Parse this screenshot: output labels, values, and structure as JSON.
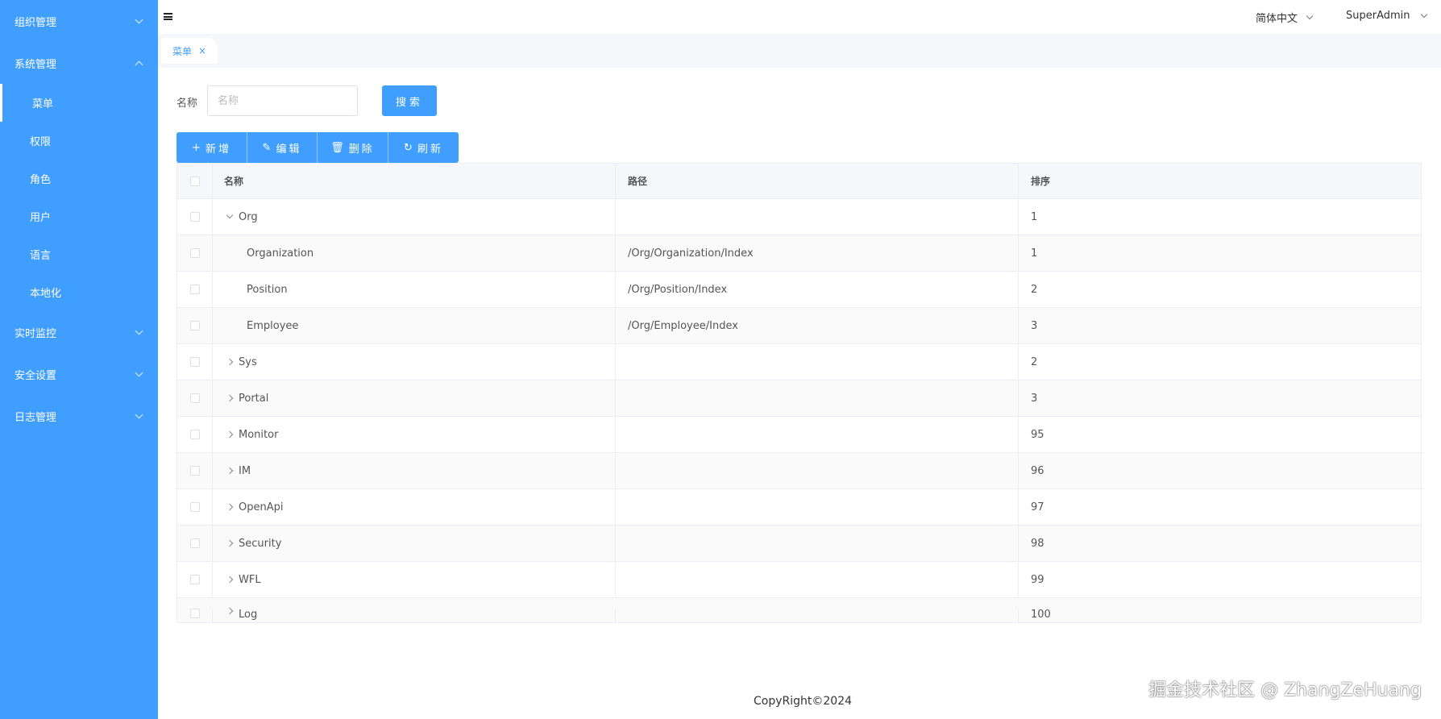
{
  "sidebar": {
    "groups": [
      {
        "label": "组织管理",
        "expanded": false
      },
      {
        "label": "系统管理",
        "expanded": true
      },
      {
        "label": "实时监控",
        "expanded": false
      },
      {
        "label": "安全设置",
        "expanded": false
      },
      {
        "label": "日志管理",
        "expanded": false
      }
    ],
    "system_items": [
      "菜单",
      "权限",
      "角色",
      "用户",
      "语言",
      "本地化"
    ],
    "active_item": "菜单"
  },
  "header": {
    "language": "简体中文",
    "user": "SuperAdmin"
  },
  "tabs": [
    {
      "label": "菜单",
      "close": "×"
    }
  ],
  "search": {
    "label": "名称",
    "placeholder": "名称",
    "button": "搜索"
  },
  "toolbar": {
    "add": "新增",
    "edit": "编辑",
    "delete": "删除",
    "refresh": "刷新"
  },
  "table": {
    "headers": [
      "名称",
      "路径",
      "排序"
    ],
    "rows": [
      {
        "name": "Org",
        "path": "",
        "sort": "1",
        "level": 0,
        "expanded": true
      },
      {
        "name": "Organization",
        "path": "/Org/Organization/Index",
        "sort": "1",
        "level": 1
      },
      {
        "name": "Position",
        "path": "/Org/Position/Index",
        "sort": "2",
        "level": 1
      },
      {
        "name": "Employee",
        "path": "/Org/Employee/Index",
        "sort": "3",
        "level": 1
      },
      {
        "name": "Sys",
        "path": "",
        "sort": "2",
        "level": 0,
        "expanded": false
      },
      {
        "name": "Portal",
        "path": "",
        "sort": "3",
        "level": 0,
        "expanded": false
      },
      {
        "name": "Monitor",
        "path": "",
        "sort": "95",
        "level": 0,
        "expanded": false
      },
      {
        "name": "IM",
        "path": "",
        "sort": "96",
        "level": 0,
        "expanded": false
      },
      {
        "name": "OpenApi",
        "path": "",
        "sort": "97",
        "level": 0,
        "expanded": false
      },
      {
        "name": "Security",
        "path": "",
        "sort": "98",
        "level": 0,
        "expanded": false
      },
      {
        "name": "WFL",
        "path": "",
        "sort": "99",
        "level": 0,
        "expanded": false
      },
      {
        "name": "Log",
        "path": "",
        "sort": "100",
        "level": 0,
        "expanded": false
      }
    ]
  },
  "footer": "CopyRight©2024",
  "watermark": "掘金技术社区 @ ZhangZeHuang",
  "colors": {
    "primary": "#409eff",
    "header_bg": "#f5f7fa",
    "border": "#ebeef5"
  }
}
